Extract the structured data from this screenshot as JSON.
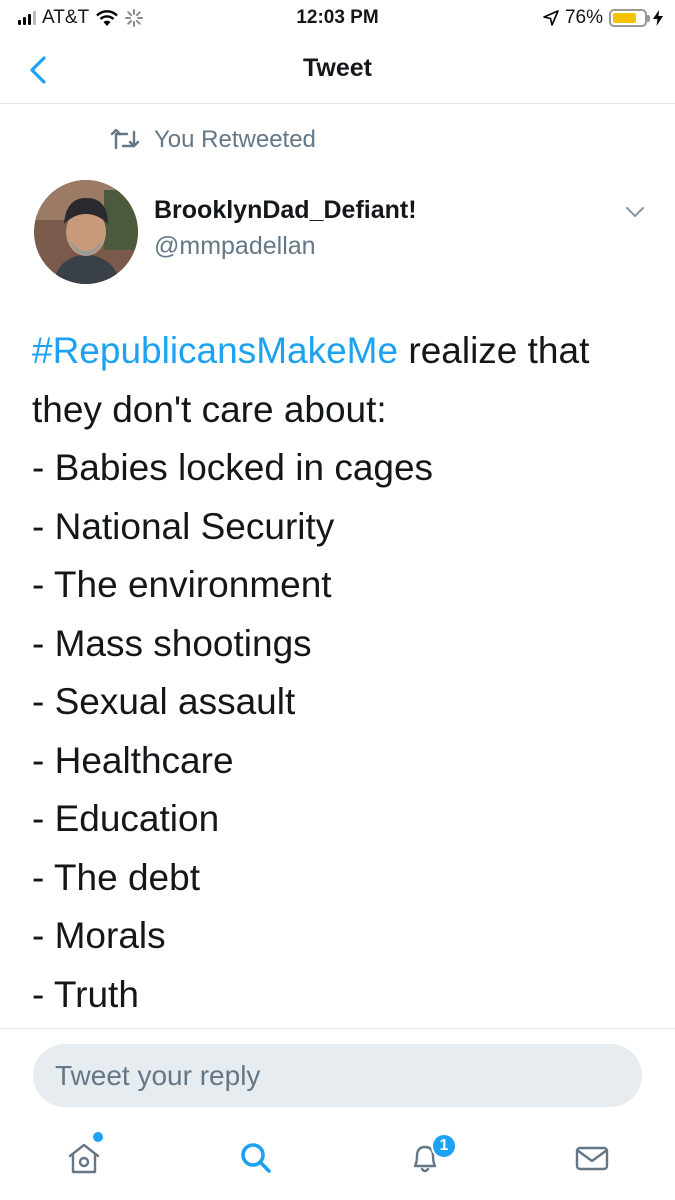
{
  "status_bar": {
    "carrier": "AT&T",
    "time": "12:03 PM",
    "battery_percent": "76%",
    "battery_level": 0.76
  },
  "nav": {
    "title": "Tweet"
  },
  "retweet_context": {
    "label": "You Retweeted"
  },
  "author": {
    "display_name": "BrooklynDad_Defiant!",
    "handle": "@mmpadellan"
  },
  "tweet": {
    "hashtag": "#RepublicansMakeMe",
    "intro_rest": " realize that",
    "line2": "they don't care about:",
    "items": [
      "- Babies locked in cages",
      "- National Security",
      "- The environment",
      "- Mass shootings",
      "- Sexual assault",
      "- Healthcare",
      "- Education",
      "- The debt",
      "- Morals",
      "- Truth"
    ]
  },
  "reply": {
    "placeholder": "Tweet your reply"
  },
  "tab_bar": {
    "notifications_badge": "1"
  },
  "colors": {
    "accent": "#1da1f2",
    "secondary_text": "#657786",
    "divider": "#e1e8ed",
    "reply_bg": "#e6ecf0"
  }
}
